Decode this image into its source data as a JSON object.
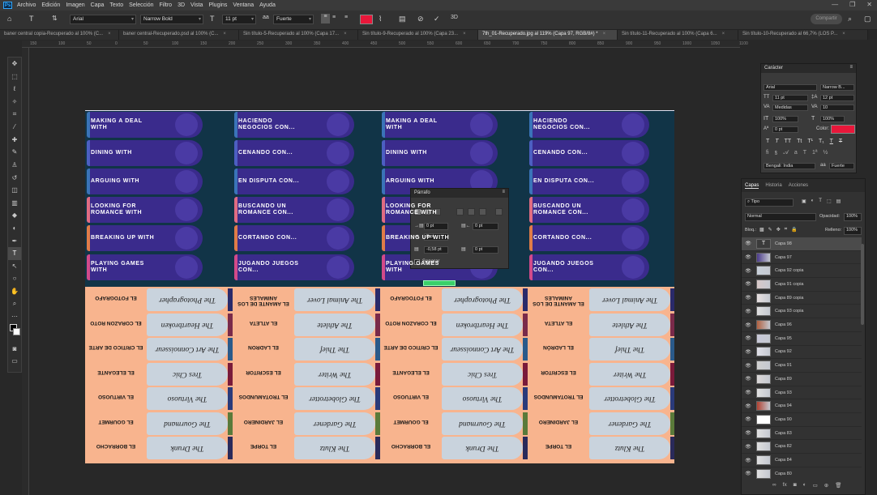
{
  "menu": {
    "items": [
      "Archivo",
      "Edición",
      "Imagen",
      "Capa",
      "Texto",
      "Selección",
      "Filtro",
      "3D",
      "Vista",
      "Plugins",
      "Ventana",
      "Ayuda"
    ]
  },
  "options": {
    "font_family": "Arial",
    "font_style": "Narrow Bold",
    "font_size": "11 pt",
    "antialias": "Fuerte",
    "color": "#e8173a",
    "share": "Compartir"
  },
  "tabs": [
    {
      "label": "baner central copia-Recuperado al 100% (C...",
      "active": false
    },
    {
      "label": "baner central-Recuperado.psd al 100% (C...",
      "active": false
    },
    {
      "label": "Sin título-5-Recuperado al 100% (Capa 17...",
      "active": false
    },
    {
      "label": "Sin título-9-Recuperado al 100% (Capa 23...",
      "active": false
    },
    {
      "label": "7th_01-Recuperado.jpg al 119% (Capa 97, RGB/8#) *",
      "active": true
    },
    {
      "label": "Sin título-11-Recuperado al 100% (Capa 6...",
      "active": false
    },
    {
      "label": "Sin título-10-Recuperado al 66,7% (LOS P...",
      "active": false
    }
  ],
  "ruler": {
    "ticks": [
      "150",
      "100",
      "50",
      "0",
      "50",
      "100",
      "150",
      "200",
      "250",
      "300",
      "350",
      "400",
      "450",
      "500",
      "550",
      "600",
      "650",
      "700",
      "750",
      "800",
      "850",
      "900",
      "950",
      "1000",
      "1050",
      "1100"
    ]
  },
  "canvas": {
    "cards_en": [
      "MAKING A DEAL WITH",
      "DINING WITH",
      "ARGUING WITH",
      "LOOKING FOR ROMANCE WITH",
      "BREAKING UP WITH",
      "PLAYING GAMES WITH"
    ],
    "cards_es": [
      "HACIENDO NEGOCIOS CON...",
      "CENANDO CON...",
      "EN DISPUTA CON...",
      "BUSCANDO UN ROMANCE CON...",
      "CORTANDO CON...",
      "JUGANDO JUEGOS CON..."
    ],
    "people_en_a": [
      "The Photographer",
      "The Heartbroken",
      "The Art Connoisseur",
      "Tres Chic",
      "The Virtuoso",
      "The Gourmand",
      "The Drunk"
    ],
    "labels_es_a": [
      "EL FOTOGRAFO",
      "EL CORAZON ROTO",
      "EL CRITICO DE ARTE",
      "EL ELEGANTE",
      "EL VIRTUOSO",
      "EL GOURMET",
      "EL BORRACHO"
    ],
    "people_en_b": [
      "The Animal Lover",
      "The Athlete",
      "The Thief",
      "The Writer",
      "The Globetrotter",
      "The Gardener",
      "The Klutz"
    ],
    "labels_es_b": [
      "EL AMANTE DE LOS ANIMALES",
      "EL ATLETA",
      "EL LADRON",
      "EL ESCRITOR",
      "EL TROTAMUNDOS",
      "EL JARDINERO",
      "EL TORPE"
    ],
    "labels_es_b2": [
      "EL AMANTE DE LOS ANIMALES",
      "EL ATLETA",
      "EL LADRÓN",
      "EL ESCRITOR",
      "EL TROTAMUNDOS",
      "EL JARDINERO",
      "EL TORPE"
    ]
  },
  "parrafo": {
    "title": "Párrafo",
    "indent_left": "0 pt",
    "indent_right": "0 pt",
    "first_line": "0 pt",
    "space_before": "-0,58 pt",
    "space_after": "0 pt",
    "hyphen": "Separar"
  },
  "caracter": {
    "title": "Carácter",
    "font": "Arial",
    "style": "Narrow B...",
    "size": "11 pt",
    "leading": "12 pt",
    "kerning": "Medidas",
    "tracking": "10",
    "vscale": "100%",
    "hscale": "100%",
    "baseline": "0 pt",
    "color_label": "Color:",
    "color": "#e8173a",
    "language": "Bengali: India",
    "aa": "Fuerte"
  },
  "layers": {
    "tabs": [
      "Capas",
      "Historia",
      "Acciones"
    ],
    "filter": "Tipo",
    "blend": "Normal",
    "opacity_label": "Opacidad:",
    "opacity": "100%",
    "lock_label": "Bloq.:",
    "fill_label": "Relleno:",
    "fill": "100%",
    "items": [
      {
        "name": "Capa 98",
        "thumb": "text",
        "selected": true
      },
      {
        "name": "Capa 97",
        "thumb": "img",
        "selected": false
      },
      {
        "name": "Capa 92 copia",
        "thumb": "img",
        "selected": false
      },
      {
        "name": "Capa 91 copia",
        "thumb": "img",
        "selected": false
      },
      {
        "name": "Capa 89 copia",
        "thumb": "img",
        "selected": false
      },
      {
        "name": "Capa 93 copia",
        "thumb": "img",
        "selected": false
      },
      {
        "name": "Capa 96",
        "thumb": "img",
        "selected": false
      },
      {
        "name": "Capa 95",
        "thumb": "img",
        "selected": false
      },
      {
        "name": "Capa 92",
        "thumb": "img",
        "selected": false
      },
      {
        "name": "Capa 91",
        "thumb": "img",
        "selected": false
      },
      {
        "name": "Capa 89",
        "thumb": "img",
        "selected": false
      },
      {
        "name": "Capa 93",
        "thumb": "img",
        "selected": false
      },
      {
        "name": "Capa 94",
        "thumb": "img",
        "selected": false
      },
      {
        "name": "Capa 90",
        "thumb": "white",
        "selected": false
      },
      {
        "name": "Capa 83",
        "thumb": "img",
        "selected": false
      },
      {
        "name": "Capa 82",
        "thumb": "img",
        "selected": false
      },
      {
        "name": "Capa 84",
        "thumb": "img",
        "selected": false
      },
      {
        "name": "Capa 80",
        "thumb": "img",
        "selected": false
      }
    ]
  }
}
